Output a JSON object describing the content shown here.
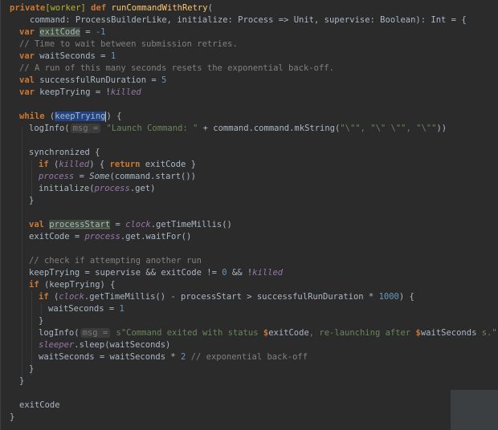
{
  "code": {
    "l1_private": "private",
    "l1_worker": "[worker]",
    "l1_def": "def",
    "l1_fn": "runCommandWithRetry",
    "l1_paren": "(",
    "l2_text": "command: ProcessBuilderLike, initialize: Process => Unit, supervise: Boolean): Int = {",
    "l3_var": "var",
    "l3_name": "exitCode",
    "l3_eq": " = ",
    "l3_val": "-1",
    "l4_comment": "// Time to wait between submission retries.",
    "l5_var": "var",
    "l5_name": "waitSeconds",
    "l5_eq": " = ",
    "l5_val": "1",
    "l6_comment": "// A run of this many seconds resets the exponential back-off.",
    "l7_val": "val",
    "l7_name": "successfulRunDuration",
    "l7_eq": " = ",
    "l7_num": "5",
    "l8_var": "var",
    "l8_name": "keepTrying",
    "l8_eq": " = !",
    "l8_field": "killed",
    "l10_while": "while",
    "l10_open": " (",
    "l10_sel": "keepTrying",
    "l10_close": ") {",
    "l11_fn": "logInfo(",
    "l11_hint": "msg =",
    "l11_str1": "\"Launch Command: \"",
    "l11_mid": " + command.command.mkString(",
    "l11_str2": "\"\\\"\", \"\\\" \\\"\", \"\\\"\"",
    "l11_end": "))",
    "l13_text": "synchronized {",
    "l14_if": "if",
    "l14_open": " (",
    "l14_field": "killed",
    "l14_close": ") { ",
    "l14_return": "return",
    "l14_end": " exitCode }",
    "l15_field": "process",
    "l15_eq": " = ",
    "l15_some": "Some",
    "l15_end": "(command.start())",
    "l16_text": "initialize(",
    "l16_field": "process",
    "l16_end": ".get)",
    "l17_text": "}",
    "l19_val": "val",
    "l19_name": "processStart",
    "l19_eq": " = ",
    "l19_field": "clock",
    "l19_end": ".getTimeMillis()",
    "l20_text": "exitCode = ",
    "l20_field": "process",
    "l20_end": ".get.waitFor()",
    "l22_comment": "// check if attempting another run",
    "l23_text": "keepTrying = supervise && exitCode != ",
    "l23_num": "0",
    "l23_mid": " && !",
    "l23_field": "killed",
    "l24_if": "if",
    "l24_text": " (keepTrying) {",
    "l25_if": "if",
    "l25_open": " (",
    "l25_field": "clock",
    "l25_mid": ".getTimeMillis() - processStart > successfulRunDuration * ",
    "l25_num": "1000",
    "l25_end": ") {",
    "l26_text": "waitSeconds = ",
    "l26_num": "1",
    "l27_text": "}",
    "l28_fn": "logInfo(",
    "l28_hint": "msg =",
    "l28_s": "s",
    "l28_str1": "\"Command exited with status ",
    "l28_interp1": "$",
    "l28_var1": "exitCode",
    "l28_str2": ", re-launching after ",
    "l28_interp2": "$",
    "l28_var2": "waitSeconds",
    "l28_str3": " s.\"",
    "l28_end": ")",
    "l29_field": "sleeper",
    "l29_end": ".sleep(waitSeconds)",
    "l30_text": "waitSeconds = waitSeconds * ",
    "l30_num": "2",
    "l30_comment": " // exponential back-off",
    "l31_text": "}",
    "l32_text": "}",
    "l34_text": "exitCode",
    "l35_text": "}"
  },
  "colors": {
    "background": "#2b2b2b",
    "keyword": "#cc7832",
    "function": "#ffc66d",
    "string": "#6a8759",
    "number": "#6897bb",
    "comment": "#808080",
    "field": "#9876aa",
    "annotation": "#bbb529"
  }
}
